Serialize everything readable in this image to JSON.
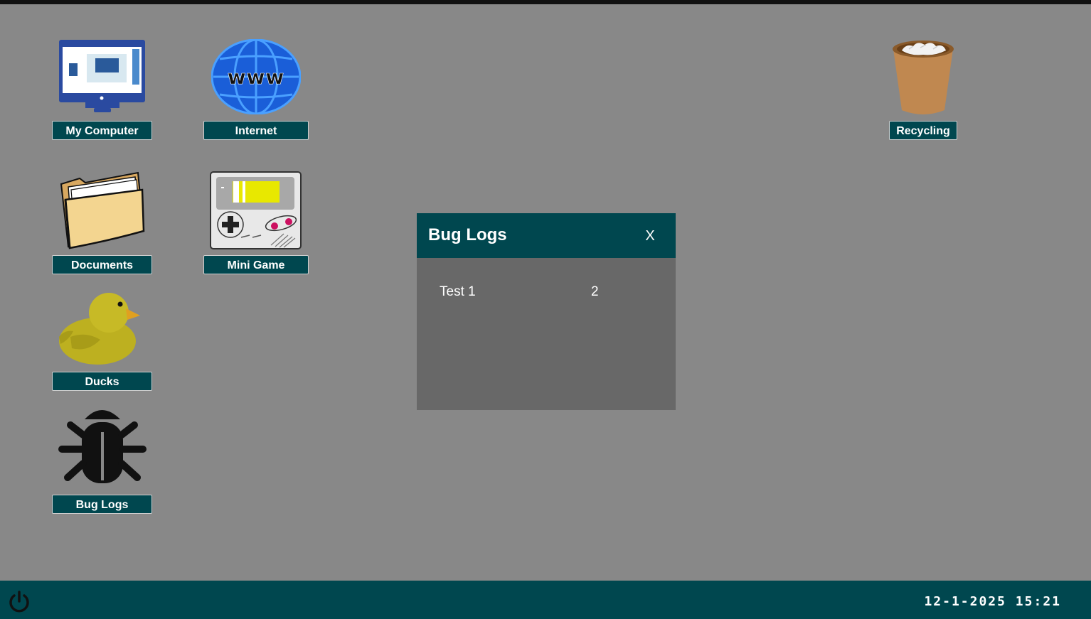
{
  "desktop": {
    "icons": [
      {
        "label": "My Computer",
        "icon": "monitor-icon"
      },
      {
        "label": "Internet",
        "icon": "globe-www-icon"
      },
      {
        "label": "Recycling",
        "icon": "recycle-bin-icon"
      },
      {
        "label": "Documents",
        "icon": "folder-icon"
      },
      {
        "label": "Mini Game",
        "icon": "gameboy-icon"
      },
      {
        "label": "Ducks",
        "icon": "duck-icon"
      },
      {
        "label": "Bug Logs",
        "icon": "bug-icon"
      }
    ]
  },
  "window": {
    "title": "Bug Logs",
    "close_label": "X",
    "rows": [
      {
        "name": "Test 1",
        "count": "2"
      }
    ]
  },
  "taskbar": {
    "power_icon": "power-icon",
    "clock": "12-1-2025 15:21"
  },
  "colors": {
    "desktop_bg": "#888888",
    "accent": "#00474f",
    "window_body": "#686868"
  }
}
